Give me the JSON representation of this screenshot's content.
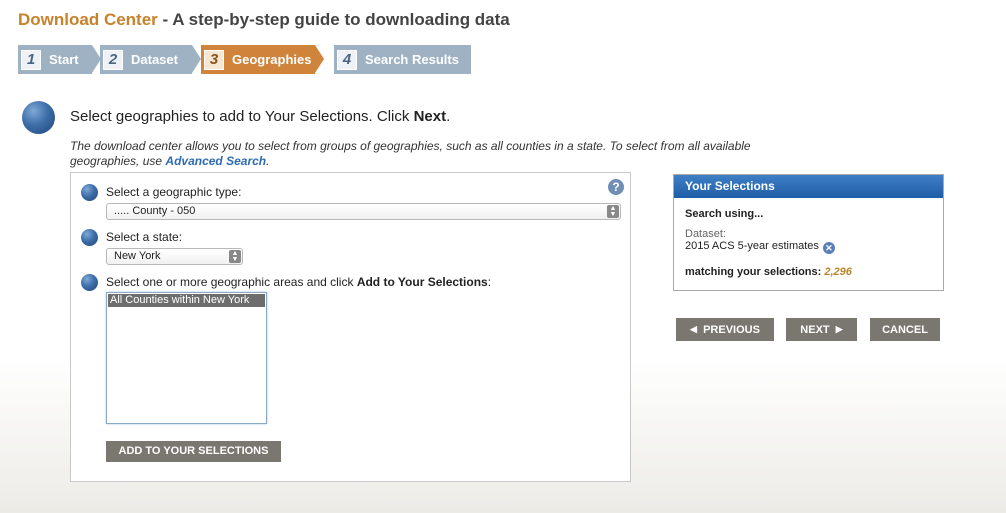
{
  "header": {
    "brand": "Download Center",
    "subtitle": " - A step-by-step guide to downloading data"
  },
  "steps": [
    {
      "num": "1",
      "label": "Start"
    },
    {
      "num": "2",
      "label": "Dataset"
    },
    {
      "num": "3",
      "label": "Geographies"
    },
    {
      "num": "4",
      "label": "Search Results"
    }
  ],
  "instruction": {
    "text": "Select geographies to add to Your Selections. Click ",
    "emphasis": "Next",
    "end": "."
  },
  "description": {
    "text": "The download center allows you to select from groups of geographies, such as all counties in a state. To select from all available geographies, use ",
    "link": "Advanced Search",
    "end": "."
  },
  "form": {
    "geo_type_label": "Select a geographic type:",
    "geo_type_value": "..... County - 050",
    "state_label": "Select a state:",
    "state_value": "New York",
    "areas_label": "Select one or more geographic areas and click ",
    "areas_label_bold": "Add to Your Selections",
    "areas_label_end": ":",
    "areas_options": [
      "All Counties within New York"
    ],
    "add_button": "ADD TO YOUR SELECTIONS",
    "help_glyph": "?"
  },
  "selections": {
    "title": "Your Selections",
    "search_using": "Search using...",
    "dataset_label": "Dataset:",
    "dataset_value": "2015 ACS 5-year estimates",
    "matching_label": "matching your selections:",
    "matching_count": "2,296"
  },
  "nav": {
    "previous": "PREVIOUS",
    "next": "NEXT",
    "cancel": "CANCEL"
  },
  "icons": {
    "help": "help-icon",
    "remove": "remove-icon",
    "step_ball": "bullet-ball-icon"
  },
  "colors": {
    "brand": "#c8812c",
    "active_step": "#d0833a",
    "inactive_step": "#9fb2c4",
    "selection_header": "#1f5ea6",
    "button": "#7a7670"
  }
}
